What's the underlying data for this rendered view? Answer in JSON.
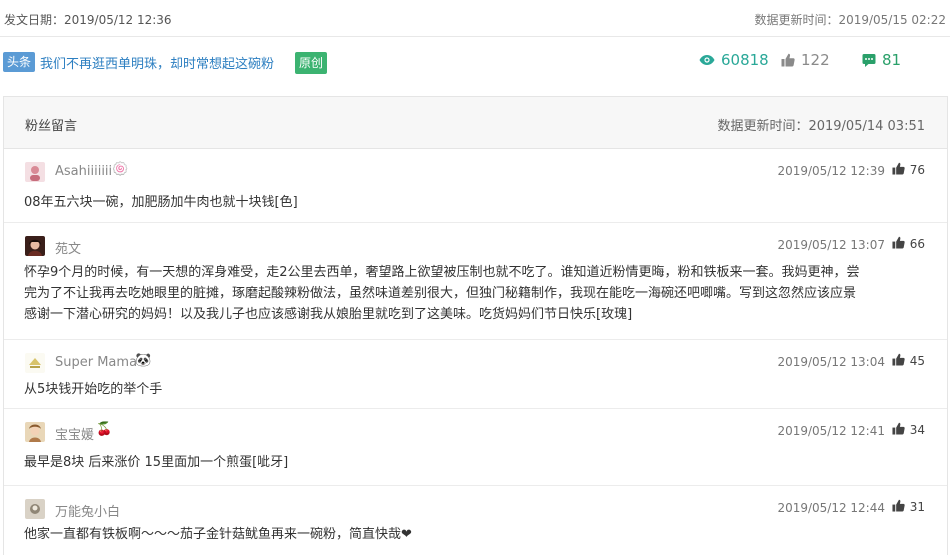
{
  "topbar": {
    "publish_label": "发文日期：2019/05/12 12:36",
    "update_label": "数据更新时间：2019/05/15 02:22"
  },
  "article": {
    "tag_head": "头条",
    "title": "我们不再逛西单明珠，却时常想起这碗粉",
    "tag_original": "原创",
    "views": "60818",
    "likes": "122",
    "comments": "81",
    "icons": {
      "views": "eye-icon",
      "likes": "thumbs-up-icon",
      "comments": "comment-icon"
    },
    "colors": {
      "views": "#2aa898",
      "comments": "#2aa06a",
      "tag_head": "#5b9bd5",
      "tag_original": "#3cb371"
    }
  },
  "panel": {
    "title": "粉丝留言",
    "updated": "数据更新时间：2019/05/14 03:51"
  },
  "comments": [
    {
      "user": "Asahiiiiiii",
      "badge": "🍥",
      "time": "2019/05/12 12:39",
      "likes": "76",
      "text": "08年五六块一碗，加肥肠加牛肉也就十块钱[色]"
    },
    {
      "user": "苑文",
      "badge": "",
      "time": "2019/05/12 13:07",
      "likes": "66",
      "text_lines": [
        "怀孕9个月的时候，有一天想的浑身难受，走2公里去西单，奢望路上欲望被压制也就不吃了。谁知道近粉情更晦，粉和铁板来一套。我妈更神，尝",
        "完为了不让我再去吃她眼里的脏摊，琢磨起酸辣粉做法，虽然味道差别很大，但独门秘籍制作，我现在能吃一海碗还吧唧嘴。写到这忽然应该应景",
        "感谢一下潜心研究的妈妈！以及我儿子也应该感谢我从娘胎里就吃到了这美味。吃货妈妈们节日快乐[玫瑰]"
      ]
    },
    {
      "user": "Super Mama",
      "badge": "🐼",
      "time": "2019/05/12 13:04",
      "likes": "45",
      "text": "从5块钱开始吃的举个手"
    },
    {
      "user": "宝宝媛",
      "badge": "🍒",
      "time": "2019/05/12 12:41",
      "likes": "34",
      "text": "最早是8块 后来涨价 15里面加一个煎蛋[呲牙]"
    },
    {
      "user": "万能兔小白",
      "badge": "",
      "time": "2019/05/12 12:44",
      "likes": "31",
      "text": "他家一直都有铁板啊～～～茄子金针菇鱿鱼再来一碗粉，简直快哉❤"
    }
  ]
}
